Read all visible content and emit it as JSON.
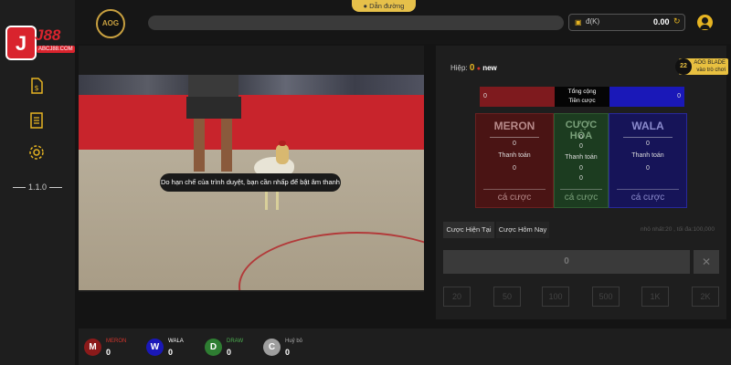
{
  "sidebar": {
    "logo_badge": "J",
    "logo_text": "J88",
    "logo_sub": "ABCJ88.COM",
    "version": "1.1.0"
  },
  "topbar": {
    "game_logo": "AOG",
    "guide_label": "Dẫn đường",
    "wallet_unit": "đ(K)",
    "balance": "0.00"
  },
  "video": {
    "sound_notice": "Do hạn chế của trình duyệt, bạn cần nhấp để bật âm thanh"
  },
  "betting": {
    "round_label": "Hiệp:",
    "round_number": "0",
    "round_status": "new",
    "blade_brand": "AOG BLADE",
    "blade_sub": "vào trò chơi",
    "totals": {
      "meron_total": "0",
      "title_line1": "Tổng cộng",
      "title_line2": "Tiền cược",
      "wala_total": "0"
    },
    "sides": [
      {
        "name": "MERON",
        "lines": [
          "0",
          "Thanh toán",
          "0"
        ],
        "button": "cá cược"
      },
      {
        "name": "CƯỢC HÒA",
        "lines": [
          "0",
          "0",
          "Thanh toán",
          "0",
          "0"
        ],
        "button": "cá cược"
      },
      {
        "name": "WALA",
        "lines": [
          "0",
          "Thanh toán",
          "0"
        ],
        "button": "cá cược"
      }
    ],
    "tabs": [
      "Cược Hiện Tại",
      "Cược Hôm Nay"
    ],
    "limits": "nhỏ nhất:20 , tối đa:100,000",
    "amount": "0",
    "clear": "✕",
    "chips": [
      "20",
      "50",
      "100",
      "500",
      "1K",
      "2K"
    ]
  },
  "stats": [
    {
      "letter": "M",
      "label": "MERON",
      "value": "0",
      "color": "#8b1a1a",
      "label_color": "#d0342c"
    },
    {
      "letter": "W",
      "label": "WALA",
      "value": "0",
      "color": "#1a18b8",
      "label_color": "#ffffff"
    },
    {
      "letter": "D",
      "label": "DRAW",
      "value": "0",
      "color": "#2e7d32",
      "label_color": "#4caf50"
    },
    {
      "letter": "C",
      "label": "Huỷ bỏ",
      "value": "0",
      "color": "#9e9e9e",
      "label_color": "#aaaaaa"
    }
  ]
}
